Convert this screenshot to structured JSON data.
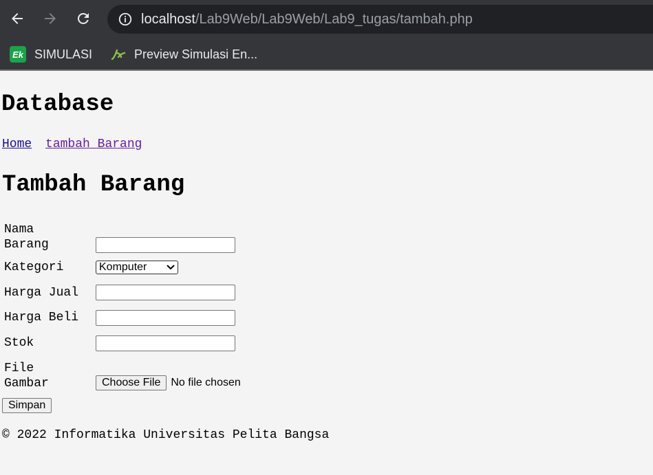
{
  "browser": {
    "url_host": "localhost",
    "url_path": "/Lab9Web/Lab9Web/Lab9_tugas/tambah.php",
    "bookmarks": [
      {
        "label": "SIMULASI",
        "icon": "ek-icon"
      },
      {
        "label": "Preview Simulasi En...",
        "icon": "leaf-icon"
      }
    ]
  },
  "header": {
    "title": "Database"
  },
  "nav": {
    "links": [
      "Home",
      "tambah Barang"
    ]
  },
  "main": {
    "title": "Tambah Barang",
    "fields": {
      "nama_label": "Nama Barang",
      "kategori_label": "Kategori",
      "kategori_value": "Komputer",
      "harga_jual_label": "Harga Jual",
      "harga_beli_label": "Harga Beli",
      "stok_label": "Stok",
      "file_label": "File Gambar",
      "file_button": "Choose File",
      "file_status": "No file chosen"
    },
    "submit_label": "Simpan"
  },
  "footer": {
    "text": "© 2022 Informatika Universitas Pelita Bangsa"
  }
}
